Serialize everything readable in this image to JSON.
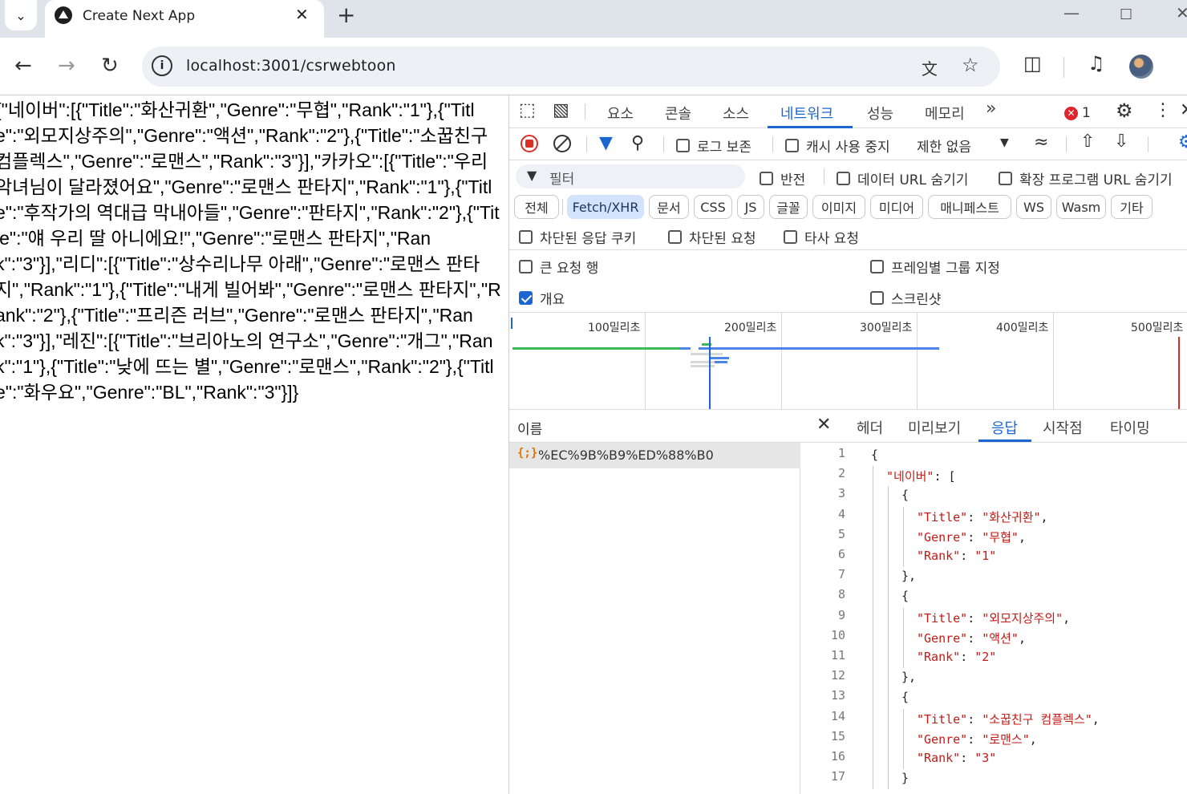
{
  "browser": {
    "tab_title": "Create Next App",
    "url": "localhost:3001/csrwebtoon",
    "error_count": "1"
  },
  "page": {
    "json_text": "{\"네이버\":[{\"Title\":\"화산귀환\",\"Genre\":\"무협\",\"Rank\":\"1\"},{\"Title\":\"외모지상주의\",\"Genre\":\"액션\",\"Rank\":\"2\"},{\"Title\":\"소꿉친구 컴플렉스\",\"Genre\":\"로맨스\",\"Rank\":\"3\"}],\"카카오\":[{\"Title\":\"우리 악녀님이 달라졌어요\",\"Genre\":\"로맨스 판타지\",\"Rank\":\"1\"},{\"Title\":\"후작가의 역대급 막내아들\",\"Genre\":\"판타지\",\"Rank\":\"2\"},{\"Title\":\"얘 우리 딸 아니에요!\",\"Genre\":\"로맨스 판타지\",\"Rank\":\"3\"}],\"리디\":[{\"Title\":\"상수리나무 아래\",\"Genre\":\"로맨스 판타지\",\"Rank\":\"1\"},{\"Title\":\"내게 빌어봐\",\"Genre\":\"로맨스 판타지\",\"Rank\":\"2\"},{\"Title\":\"프리즌 러브\",\"Genre\":\"로맨스 판타지\",\"Rank\":\"3\"}],\"레진\":[{\"Title\":\"브리아노의 연구소\",\"Genre\":\"개그\",\"Rank\":\"1\"},{\"Title\":\"낮에 뜨는 별\",\"Genre\":\"로맨스\",\"Rank\":\"2\"},{\"Title\":\"화우요\",\"Genre\":\"BL\",\"Rank\":\"3\"}]}"
  },
  "devtools": {
    "tabs": [
      "요소",
      "콘솔",
      "소스",
      "네트워크",
      "성능",
      "메모리"
    ],
    "active_tab": "네트워크",
    "more_tabs": "»",
    "toolbar": {
      "preserve_log": "로그 보존",
      "disable_cache": "캐시 사용 중지",
      "throttle": "제한 없음"
    },
    "filter": {
      "placeholder": "필터",
      "invert": "반전",
      "hide_data_urls": "데이터 URL 숨기기",
      "hide_ext_urls": "확장 프로그램 URL 숨기기"
    },
    "type_filters": [
      "전체",
      "Fetch/XHR",
      "문서",
      "CSS",
      "JS",
      "글꼴",
      "이미지",
      "미디어",
      "매니페스트",
      "WS",
      "Wasm",
      "기타"
    ],
    "active_type": "Fetch/XHR",
    "block_filters": [
      "차단된 응답 쿠키",
      "차단된 요청",
      "타사 요청"
    ],
    "settings": {
      "big_rows": "큰 요청 행",
      "group_by_frame": "프레임별 그룹 지정",
      "overview": "개요",
      "screenshots": "스크린샷",
      "overview_checked": true
    },
    "timeline_labels": [
      "100밀리초",
      "200밀리초",
      "300밀리초",
      "400밀리초",
      "500밀리초"
    ],
    "requests": {
      "header": "이름",
      "items": [
        {
          "icon": "{;}",
          "name": "%EC%9B%B9%ED%88%B0"
        }
      ]
    },
    "detail_tabs": [
      "헤더",
      "미리보기",
      "응답",
      "시작점",
      "타이밍"
    ],
    "active_detail_tab": "응답",
    "code_lines": [
      {
        "n": "1",
        "indent": 0,
        "parts": [
          [
            "p",
            "{"
          ]
        ]
      },
      {
        "n": "2",
        "indent": 1,
        "parts": [
          [
            "s",
            "\"네이버\""
          ],
          [
            "p",
            ": ["
          ]
        ]
      },
      {
        "n": "3",
        "indent": 2,
        "parts": [
          [
            "p",
            "{"
          ]
        ]
      },
      {
        "n": "4",
        "indent": 3,
        "parts": [
          [
            "s",
            "\"Title\""
          ],
          [
            "p",
            ": "
          ],
          [
            "s",
            "\"화산귀환\""
          ],
          [
            "p",
            ","
          ]
        ]
      },
      {
        "n": "5",
        "indent": 3,
        "parts": [
          [
            "s",
            "\"Genre\""
          ],
          [
            "p",
            ": "
          ],
          [
            "s",
            "\"무협\""
          ],
          [
            "p",
            ","
          ]
        ]
      },
      {
        "n": "6",
        "indent": 3,
        "parts": [
          [
            "s",
            "\"Rank\""
          ],
          [
            "p",
            ": "
          ],
          [
            "s",
            "\"1\""
          ]
        ]
      },
      {
        "n": "7",
        "indent": 2,
        "parts": [
          [
            "p",
            "},"
          ]
        ]
      },
      {
        "n": "8",
        "indent": 2,
        "parts": [
          [
            "p",
            "{"
          ]
        ]
      },
      {
        "n": "9",
        "indent": 3,
        "parts": [
          [
            "s",
            "\"Title\""
          ],
          [
            "p",
            ": "
          ],
          [
            "s",
            "\"외모지상주의\""
          ],
          [
            "p",
            ","
          ]
        ]
      },
      {
        "n": "10",
        "indent": 3,
        "parts": [
          [
            "s",
            "\"Genre\""
          ],
          [
            "p",
            ": "
          ],
          [
            "s",
            "\"액션\""
          ],
          [
            "p",
            ","
          ]
        ]
      },
      {
        "n": "11",
        "indent": 3,
        "parts": [
          [
            "s",
            "\"Rank\""
          ],
          [
            "p",
            ": "
          ],
          [
            "s",
            "\"2\""
          ]
        ]
      },
      {
        "n": "12",
        "indent": 2,
        "parts": [
          [
            "p",
            "},"
          ]
        ]
      },
      {
        "n": "13",
        "indent": 2,
        "parts": [
          [
            "p",
            "{"
          ]
        ]
      },
      {
        "n": "14",
        "indent": 3,
        "parts": [
          [
            "s",
            "\"Title\""
          ],
          [
            "p",
            ": "
          ],
          [
            "s",
            "\"소꿉친구 컴플렉스\""
          ],
          [
            "p",
            ","
          ]
        ]
      },
      {
        "n": "15",
        "indent": 3,
        "parts": [
          [
            "s",
            "\"Genre\""
          ],
          [
            "p",
            ": "
          ],
          [
            "s",
            "\"로맨스\""
          ],
          [
            "p",
            ","
          ]
        ]
      },
      {
        "n": "16",
        "indent": 3,
        "parts": [
          [
            "s",
            "\"Rank\""
          ],
          [
            "p",
            ": "
          ],
          [
            "s",
            "\"3\""
          ]
        ]
      },
      {
        "n": "17",
        "indent": 2,
        "parts": [
          [
            "p",
            "}"
          ]
        ]
      }
    ],
    "colors": {
      "accent": "#1a67d2",
      "string": "#c41a16",
      "record": "#d93025"
    }
  }
}
